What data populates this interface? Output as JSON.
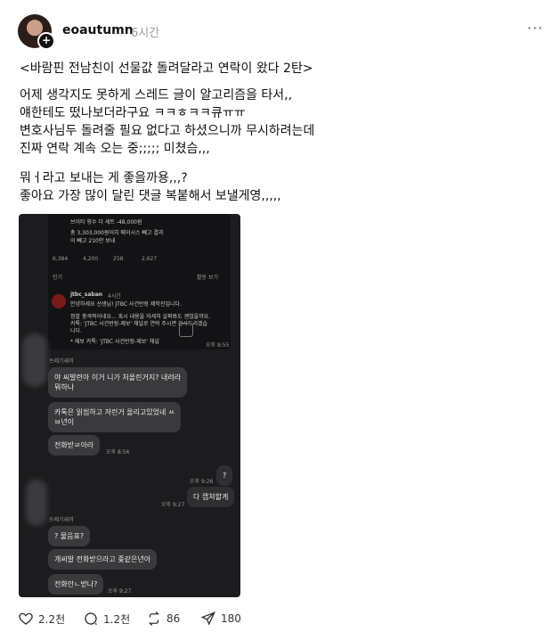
{
  "post": {
    "username": "eoautumn",
    "time": "6시간",
    "more": "···",
    "title": "<바람핀 전남친이 선물값 돌려달라고 연락이 왔다 2탄>",
    "para1": [
      "어제 생각지도 못하게 스레드 글이 알고리즘을 타서,,",
      "얘한테도 떴나보더라구요 ㅋㅋㅎㅋㅋ큐ㅠㅠ",
      "변호사님두 돌려줄 필요 없다고 하셨으니까 무시하려는데",
      "진짜 연락 계속 오는 중;;;;; 미쳤슴,,,"
    ],
    "para2": [
      "뭐ㅓ라고 보내는 게 좋을까용,,,?",
      "좋아요 가장 많이 달린 댓글 복붙해서 보낼게영,,,,,"
    ]
  },
  "screenshot": {
    "top_lines": [
      "브이티 향수 더 세트 -48,000원",
      "총 3,303,000원어치 메이시스 빼고 결과",
      "이 빼고 210만 보내"
    ],
    "stats": [
      "6,384",
      "4,200",
      "258",
      "2,627"
    ],
    "popular_label": "인기",
    "activity_label": "활동 보기",
    "jtbc_name": "jtbc_saban",
    "jtbc_time": "4시간",
    "jtbc_lines": [
      "안녕하세요 선생님! JTBC 사건반장 제작진입니다.",
      "정말 충격적이네요... 혹시 내용을 자세히 살펴봐도 괜찮을까요.",
      "카톡: 'JTBC 사건반장-제보' 채널로 연락 주시면 감사드리겠습",
      "니다."
    ],
    "jtbc_footer": "* 제보 카톡: 'JTBC 사건반장-제보' 채널",
    "t1": "오후 8:55",
    "sender1": "쓰레기새끼",
    "m1": "야 씨발련아 이거 니가 처올린거지? 내려라\n뭐하나",
    "m2": "카톡은 읽씹하고 저런거 올리고있었네 ㅆ\nㅂ년이",
    "m3": "전화받ㄹ아라",
    "t2": "오후 8:56",
    "t3": "오후 9:26",
    "me1": "?",
    "t4": "오후 9:27",
    "me2": "다 캡쳐할게",
    "sender2": "쓰레기새끼",
    "m4": "? 물음표?",
    "m5": "개씨발 전화받으라고 좆같은년아",
    "m6": "전화안ㄴ받나?",
    "t5": "오후 9:27"
  },
  "actions": {
    "likes": "2.2천",
    "comments": "1.2천",
    "reposts": "86",
    "shares": "180"
  },
  "icons": [
    "plus-icon",
    "more-icon",
    "heart-icon",
    "comment-icon",
    "repost-icon",
    "share-icon"
  ]
}
